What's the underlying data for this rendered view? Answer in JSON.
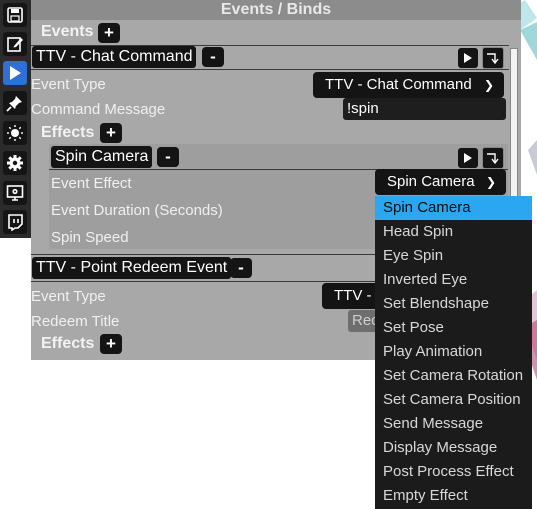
{
  "panel": {
    "title": "Events / Binds",
    "events_label": "Events",
    "add_symbol": "+",
    "remove_symbol": "-"
  },
  "events": [
    {
      "header": "TTV - Chat Command",
      "event_type_label": "Event Type",
      "event_type_value": "TTV - Chat Command",
      "field_label": "Command Message",
      "field_value": "!spin",
      "effects_label": "Effects",
      "effect": {
        "header": "Spin Camera",
        "event_effect_label": "Event Effect",
        "event_effect_value": "Spin Camera",
        "duration_label": "Event Duration (Seconds)",
        "speed_label": "Spin Speed"
      }
    },
    {
      "header": "TTV - Point Redeem Event",
      "event_type_label": "Event Type",
      "event_type_value": "TTV -",
      "field_label": "Redeem Title",
      "field_placeholder": "Rec",
      "effects_label": "Effects"
    }
  ],
  "effect_dropdown": {
    "selected": "Spin Camera",
    "options": [
      "Spin Camera",
      "Head Spin",
      "Eye Spin",
      "Inverted Eye",
      "Set Blendshape",
      "Set Pose",
      "Play Animation",
      "Set Camera Rotation",
      "Set Camera Position",
      "Send Message",
      "Display Message",
      "Post Process Effect",
      "Empty Effect"
    ]
  },
  "toolbar": {
    "icons": [
      "save-icon",
      "edit-icon",
      "play-icon",
      "pin-icon",
      "light-icon",
      "settings-icon",
      "display-settings-icon",
      "twitch-icon"
    ],
    "active_index": 2,
    "active_color": "#2f6fd6"
  },
  "colors": {
    "panel_bg": "#a8a8a8",
    "dark_control": "#141414",
    "selection": "#2aa7f0"
  }
}
